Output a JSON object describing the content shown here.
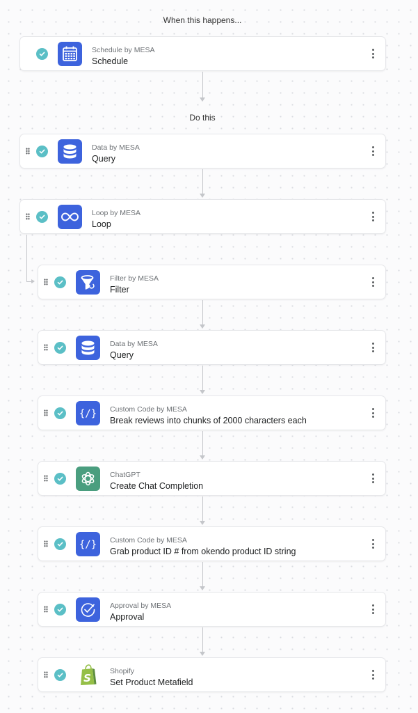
{
  "trigger_label": "When this happens...",
  "actions_label": "Do this",
  "steps": [
    {
      "app": "Schedule by MESA",
      "name": "Schedule",
      "icon": "calendar-icon",
      "status": "complete"
    },
    {
      "app": "Data by MESA",
      "name": "Query",
      "icon": "database-icon",
      "status": "complete"
    },
    {
      "app": "Loop by MESA",
      "name": "Loop",
      "icon": "infinity-icon",
      "status": "complete"
    },
    {
      "app": "Filter by MESA",
      "name": "Filter",
      "icon": "funnel-icon",
      "status": "complete"
    },
    {
      "app": "Data by MESA",
      "name": "Query",
      "icon": "database-icon",
      "status": "complete"
    },
    {
      "app": "Custom Code by MESA",
      "name": "Break reviews into chunks of 2000 characters each",
      "icon": "code-icon",
      "status": "complete"
    },
    {
      "app": "ChatGPT",
      "name": "Create Chat Completion",
      "icon": "openai-icon",
      "status": "complete"
    },
    {
      "app": "Custom Code by MESA",
      "name": "Grab product ID # from okendo product ID string",
      "icon": "code-icon",
      "status": "complete"
    },
    {
      "app": "Approval by MESA",
      "name": "Approval",
      "icon": "approval-icon",
      "status": "complete"
    },
    {
      "app": "Shopify",
      "name": "Set Product Metafield",
      "icon": "shopify-bag-icon",
      "status": "complete"
    }
  ],
  "colors": {
    "mesa_blue": "#3d63dd",
    "chatgpt_green": "#4a9e7f",
    "shopify_green": "#95bf47",
    "check_teal": "#5bbfc6"
  }
}
